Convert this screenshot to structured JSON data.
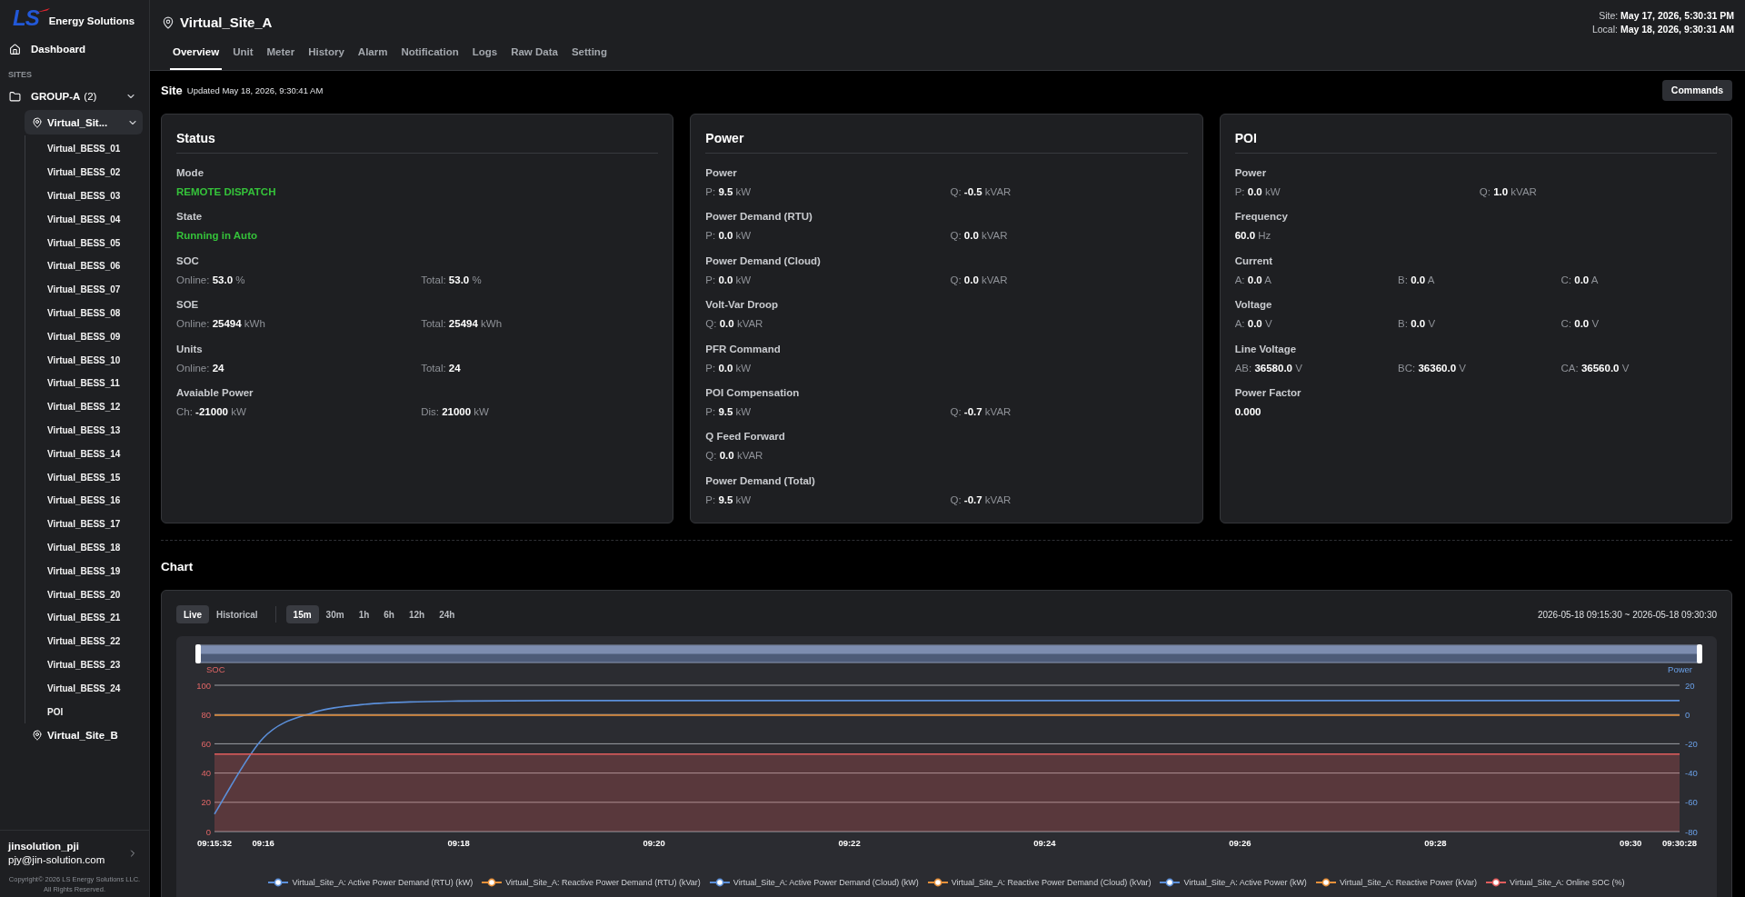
{
  "sidebar": {
    "logo": {
      "mark": "LS",
      "text": "Energy Solutions"
    },
    "dashboard": "Dashboard",
    "section": "SITES",
    "tree": [
      {
        "kind": "group",
        "label": "GROUP-A",
        "count": "(2)",
        "selected": false,
        "expanded": true,
        "children": [
          {
            "kind": "site",
            "label": "Virtual_Sit...",
            "selected": true,
            "expanded": true,
            "children": [
              {
                "kind": "unit",
                "label": "Virtual_BESS_01",
                "selected": false
              },
              {
                "kind": "unit",
                "label": "Virtual_BESS_02",
                "selected": false
              },
              {
                "kind": "unit",
                "label": "Virtual_BESS_03",
                "selected": false
              },
              {
                "kind": "unit",
                "label": "Virtual_BESS_04",
                "selected": false
              },
              {
                "kind": "unit",
                "label": "Virtual_BESS_05",
                "selected": false
              },
              {
                "kind": "unit",
                "label": "Virtual_BESS_06",
                "selected": false
              },
              {
                "kind": "unit",
                "label": "Virtual_BESS_07",
                "selected": false
              },
              {
                "kind": "unit",
                "label": "Virtual_BESS_08",
                "selected": false
              },
              {
                "kind": "unit",
                "label": "Virtual_BESS_09",
                "selected": false
              },
              {
                "kind": "unit",
                "label": "Virtual_BESS_10",
                "selected": false
              },
              {
                "kind": "unit",
                "label": "Virtual_BESS_11",
                "selected": false
              },
              {
                "kind": "unit",
                "label": "Virtual_BESS_12",
                "selected": false
              },
              {
                "kind": "unit",
                "label": "Virtual_BESS_13",
                "selected": false
              },
              {
                "kind": "unit",
                "label": "Virtual_BESS_14",
                "selected": false
              },
              {
                "kind": "unit",
                "label": "Virtual_BESS_15",
                "selected": false
              },
              {
                "kind": "unit",
                "label": "Virtual_BESS_16",
                "selected": false
              },
              {
                "kind": "unit",
                "label": "Virtual_BESS_17",
                "selected": false
              },
              {
                "kind": "unit",
                "label": "Virtual_BESS_18",
                "selected": false
              },
              {
                "kind": "unit",
                "label": "Virtual_BESS_19",
                "selected": false
              },
              {
                "kind": "unit",
                "label": "Virtual_BESS_20",
                "selected": false
              },
              {
                "kind": "unit",
                "label": "Virtual_BESS_21",
                "selected": false
              },
              {
                "kind": "unit",
                "label": "Virtual_BESS_22",
                "selected": false
              },
              {
                "kind": "unit",
                "label": "Virtual_BESS_23",
                "selected": false
              },
              {
                "kind": "unit",
                "label": "Virtual_BESS_24",
                "selected": false
              },
              {
                "kind": "unit",
                "label": "POI",
                "selected": false
              }
            ]
          },
          {
            "kind": "site",
            "label": "Virtual_Site_B",
            "selected": false,
            "expanded": false
          }
        ]
      }
    ],
    "user": {
      "name": "jinsolution_pji",
      "email": "pjy@jin-solution.com"
    },
    "copyright": [
      "Copyright© 2026 LS Energy Solutions LLC.",
      "All Rights Reserved."
    ]
  },
  "header": {
    "title": "Virtual_Site_A",
    "tabs": [
      {
        "label": "Overview",
        "selected": true
      },
      {
        "label": "Unit",
        "selected": false
      },
      {
        "label": "Meter",
        "selected": false
      },
      {
        "label": "History",
        "selected": false
      },
      {
        "label": "Alarm",
        "selected": false
      },
      {
        "label": "Notification",
        "selected": false
      },
      {
        "label": "Logs",
        "selected": false
      },
      {
        "label": "Raw Data",
        "selected": false
      },
      {
        "label": "Setting",
        "selected": false
      }
    ],
    "clock": [
      {
        "label": "Site:",
        "value": "May 17, 2026, 5:30:31 PM"
      },
      {
        "label": "Local:",
        "value": "May 18, 2026, 9:30:31 AM"
      }
    ]
  },
  "site_bar": {
    "title": "Site",
    "updated": "Updated May 18, 2026, 9:30:41 AM",
    "button": "Commands"
  },
  "cards": [
    {
      "title": "Status",
      "groups": [
        {
          "label": "Mode",
          "kind": "status",
          "text": "REMOTE DISPATCH"
        },
        {
          "label": "State",
          "kind": "status",
          "text": "Running in Auto"
        },
        {
          "label": "SOC",
          "kind": "readings",
          "readings": [
            {
              "label": "Online:",
              "value": "53.0",
              "unit": "%"
            },
            {
              "label": "Total:",
              "value": "53.0",
              "unit": "%"
            }
          ]
        },
        {
          "label": "SOE",
          "kind": "readings",
          "readings": [
            {
              "label": "Online:",
              "value": "25494",
              "unit": "kWh"
            },
            {
              "label": "Total:",
              "value": "25494",
              "unit": "kWh"
            }
          ]
        },
        {
          "label": "Units",
          "kind": "readings",
          "readings": [
            {
              "label": "Online:",
              "value": "24"
            },
            {
              "label": "Total:",
              "value": "24"
            }
          ]
        },
        {
          "label": "Avaiable Power",
          "kind": "readings",
          "readings": [
            {
              "label": "Ch:",
              "value": "-21000",
              "unit": "kW"
            },
            {
              "label": "Dis:",
              "value": "21000",
              "unit": "kW"
            }
          ]
        }
      ]
    },
    {
      "title": "Power",
      "groups": [
        {
          "label": "Power",
          "kind": "readings",
          "readings": [
            {
              "label": "P:",
              "value": "9.5",
              "unit": "kW"
            },
            {
              "label": "Q:",
              "value": "-0.5",
              "unit": "kVAR"
            }
          ]
        },
        {
          "label": "Power Demand (RTU)",
          "kind": "readings",
          "readings": [
            {
              "label": "P:",
              "value": "0.0",
              "unit": "kW"
            },
            {
              "label": "Q:",
              "value": "0.0",
              "unit": "kVAR"
            }
          ]
        },
        {
          "label": "Power Demand (Cloud)",
          "kind": "readings",
          "readings": [
            {
              "label": "P:",
              "value": "0.0",
              "unit": "kW"
            },
            {
              "label": "Q:",
              "value": "0.0",
              "unit": "kVAR"
            }
          ]
        },
        {
          "label": "Volt-Var Droop",
          "kind": "readings",
          "readings": [
            {
              "label": "Q:",
              "value": "0.0",
              "unit": "kVAR"
            }
          ]
        },
        {
          "label": "PFR Command",
          "kind": "readings",
          "readings": [
            {
              "label": "P:",
              "value": "0.0",
              "unit": "kW"
            }
          ]
        },
        {
          "label": "POI Compensation",
          "kind": "readings",
          "readings": [
            {
              "label": "P:",
              "value": "9.5",
              "unit": "kW"
            },
            {
              "label": "Q:",
              "value": "-0.7",
              "unit": "kVAR"
            }
          ]
        },
        {
          "label": "Q Feed Forward",
          "kind": "readings",
          "readings": [
            {
              "label": "Q:",
              "value": "0.0",
              "unit": "kVAR"
            }
          ]
        },
        {
          "label": "Power Demand (Total)",
          "kind": "readings",
          "readings": [
            {
              "label": "P:",
              "value": "9.5",
              "unit": "kW"
            },
            {
              "label": "Q:",
              "value": "-0.7",
              "unit": "kVAR"
            }
          ]
        }
      ]
    },
    {
      "title": "POI",
      "groups": [
        {
          "label": "Power",
          "kind": "readings",
          "readings": [
            {
              "label": "P:",
              "value": "0.0",
              "unit": "kW"
            },
            {
              "label": "Q:",
              "value": "1.0",
              "unit": "kVAR"
            }
          ]
        },
        {
          "label": "Frequency",
          "kind": "readings",
          "readings": [
            {
              "value": "60.0",
              "unit": "Hz"
            }
          ]
        },
        {
          "label": "Current",
          "kind": "readings",
          "readings": [
            {
              "label": "A:",
              "value": "0.0",
              "unit": "A"
            },
            {
              "label": "B:",
              "value": "0.0",
              "unit": "A"
            },
            {
              "label": "C:",
              "value": "0.0",
              "unit": "A"
            }
          ]
        },
        {
          "label": "Voltage",
          "kind": "readings",
          "readings": [
            {
              "label": "A:",
              "value": "0.0",
              "unit": "V"
            },
            {
              "label": "B:",
              "value": "0.0",
              "unit": "V"
            },
            {
              "label": "C:",
              "value": "0.0",
              "unit": "V"
            }
          ]
        },
        {
          "label": "Line Voltage",
          "kind": "readings",
          "readings": [
            {
              "label": "AB:",
              "value": "36580.0",
              "unit": "V"
            },
            {
              "label": "BC:",
              "value": "36360.0",
              "unit": "V"
            },
            {
              "label": "CA:",
              "value": "36560.0",
              "unit": "V"
            }
          ]
        },
        {
          "label": "Power Factor",
          "kind": "readings",
          "readings": [
            {
              "value": "0.000"
            }
          ]
        }
      ]
    }
  ],
  "chart_section": {
    "title": "Chart",
    "modes": [
      {
        "label": "Live",
        "selected": true
      },
      {
        "label": "Historical",
        "selected": false
      }
    ],
    "ranges": [
      {
        "label": "15m",
        "selected": true
      },
      {
        "label": "30m",
        "selected": false
      },
      {
        "label": "1h",
        "selected": false
      },
      {
        "label": "6h",
        "selected": false
      },
      {
        "label": "12h",
        "selected": false
      },
      {
        "label": "24h",
        "selected": false
      }
    ],
    "period": "2026-05-18 09:15:30 ~ 2026-05-18 09:30:30",
    "chart_data": {
      "type": "line",
      "ylabel": "SOC",
      "y2label": "Power",
      "grid": true,
      "legend": "bottom",
      "x": [
        "09:15:32",
        "09:16",
        null,
        null,
        null,
        "09:18",
        null,
        null,
        null,
        "09:20",
        null,
        null,
        null,
        "09:22",
        null,
        null,
        null,
        "09:24",
        null,
        null,
        null,
        "09:26",
        null,
        null,
        null,
        "09:28",
        null,
        null,
        null,
        "09:30",
        "09:30:28"
      ],
      "ylim": [
        0,
        100
      ],
      "yticks": [
        0,
        20,
        40,
        60,
        80,
        100
      ],
      "y2lim": [
        -80,
        20
      ],
      "y2ticks": [
        -80,
        -60,
        -40,
        -20,
        0,
        20
      ],
      "series": [
        {
          "name": "Virtual_Site_A: Active Power Demand (RTU) (kW)",
          "color": "#5b8fd9",
          "axis": "y2",
          "values": [
            null,
            null,
            null,
            null,
            null,
            null,
            null,
            null,
            null,
            null,
            null,
            null,
            null,
            null,
            null,
            null,
            null,
            null,
            null,
            null,
            null,
            null,
            null,
            null,
            null,
            null,
            null,
            null,
            null,
            null,
            null
          ]
        },
        {
          "name": "Virtual_Site_A: Reactive Power Demand (RTU) (kVar)",
          "color": "#e8913a",
          "axis": "y2",
          "values": [
            null,
            null,
            null,
            null,
            null,
            null,
            null,
            null,
            null,
            null,
            null,
            null,
            null,
            null,
            null,
            null,
            null,
            null,
            null,
            null,
            null,
            null,
            null,
            null,
            null,
            null,
            null,
            null,
            null,
            null,
            null
          ]
        },
        {
          "name": "Virtual_Site_A: Active Power Demand (Cloud) (kW)",
          "color": "#5b8fd9",
          "axis": "y2",
          "values": [
            null,
            null,
            null,
            null,
            null,
            null,
            null,
            null,
            null,
            null,
            null,
            null,
            null,
            null,
            null,
            null,
            null,
            null,
            null,
            null,
            null,
            null,
            null,
            null,
            null,
            null,
            null,
            null,
            null,
            null,
            null
          ]
        },
        {
          "name": "Virtual_Site_A: Reactive Power Demand (Cloud) (kVar)",
          "color": "#e8913a",
          "axis": "y2",
          "values": [
            null,
            null,
            null,
            null,
            null,
            null,
            null,
            null,
            null,
            null,
            null,
            null,
            null,
            null,
            null,
            null,
            null,
            null,
            null,
            null,
            null,
            null,
            null,
            null,
            null,
            null,
            null,
            null,
            null,
            null,
            null
          ]
        },
        {
          "name": "Virtual_Site_A: Active Power (kW)",
          "color": "#5b8fd9",
          "axis": "y2",
          "values": [
            -68,
            -16,
            1.1,
            6.7,
            8.6,
            9.2,
            9.4,
            9.5,
            9.5,
            9.5,
            9.5,
            9.5,
            9.5,
            9.5,
            9.5,
            9.5,
            9.5,
            9.5,
            9.5,
            9.5,
            9.5,
            9.5,
            9.5,
            9.5,
            9.5,
            9.5,
            9.5,
            9.5,
            9.5,
            9.5,
            9.5
          ]
        },
        {
          "name": "Virtual_Site_A: Reactive Power (kVar)",
          "color": "#e8913a",
          "axis": "y2",
          "values": [
            -0.5,
            -0.5,
            -0.5,
            -0.5,
            -0.5,
            -0.5,
            -0.5,
            -0.5,
            -0.5,
            -0.5,
            -0.5,
            -0.5,
            -0.5,
            -0.5,
            -0.5,
            -0.5,
            -0.5,
            -0.5,
            -0.5,
            -0.5,
            -0.5,
            -0.5,
            -0.5,
            -0.5,
            -0.5,
            -0.5,
            -0.5,
            -0.5,
            -0.5,
            -0.5,
            -0.5
          ]
        },
        {
          "name": "Virtual_Site_A: Online SOC (%)",
          "color": "#e25d5d",
          "values": [
            53,
            53,
            53,
            53,
            53,
            53,
            53,
            53,
            53,
            53,
            53,
            53,
            53,
            53,
            53,
            53,
            53,
            53,
            53,
            53,
            53,
            53,
            53,
            53,
            53,
            53,
            53,
            53,
            53,
            53,
            53
          ]
        }
      ]
    }
  }
}
